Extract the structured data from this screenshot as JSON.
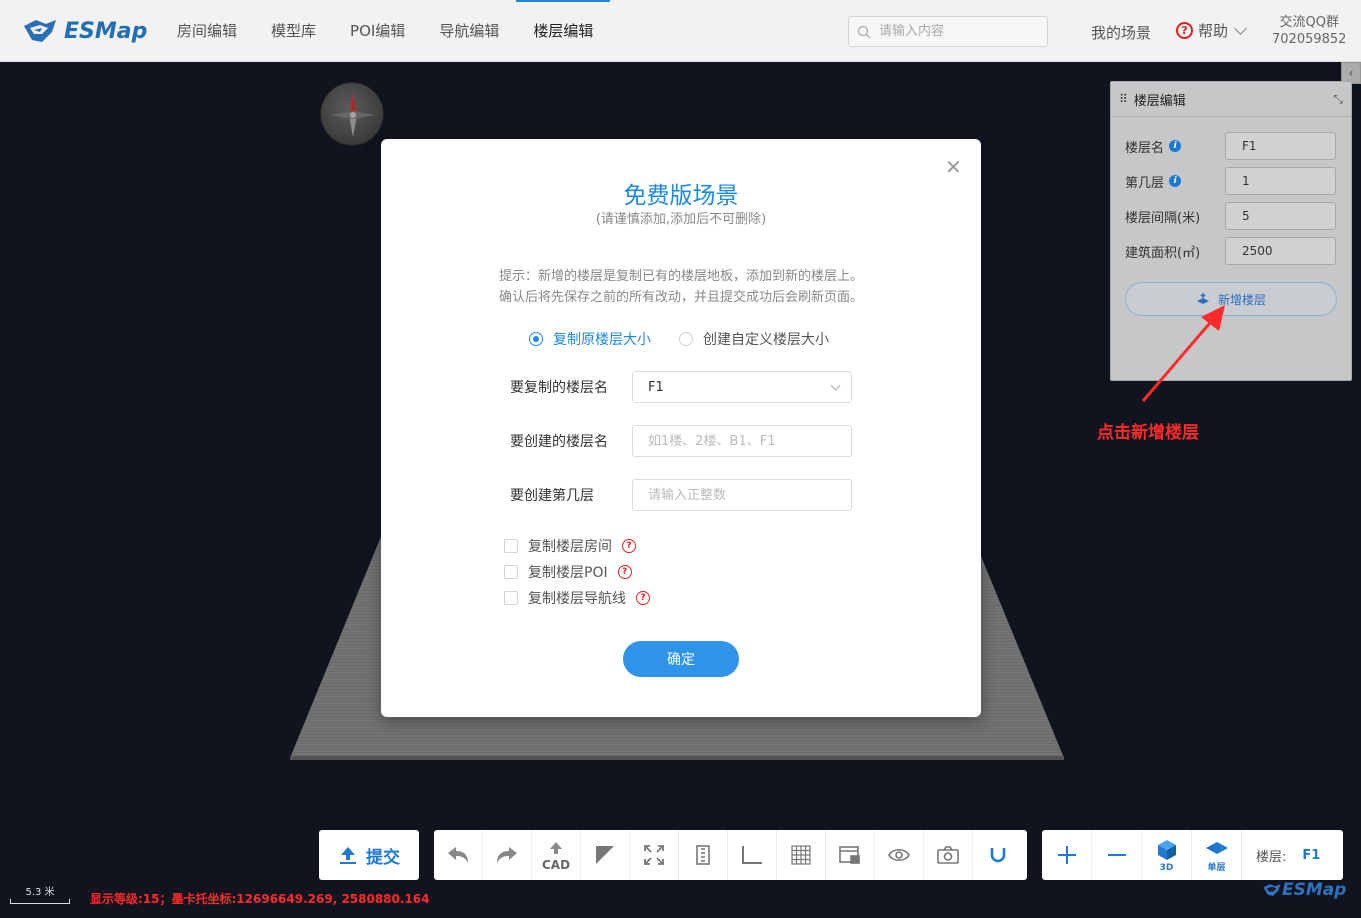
{
  "header": {
    "logo_text": "ESMap",
    "nav": [
      {
        "label": "房间编辑"
      },
      {
        "label": "模型库"
      },
      {
        "label": "POI编辑"
      },
      {
        "label": "导航编辑"
      },
      {
        "label": "楼层编辑",
        "active": true
      }
    ],
    "search_placeholder": "请输入内容",
    "my_scene": "我的场景",
    "help": "帮助",
    "qq_label": "交流QQ群",
    "qq_number": "702059852"
  },
  "panel": {
    "title": "楼层编辑",
    "fields": [
      {
        "label": "楼层名",
        "value": "F1",
        "info": true
      },
      {
        "label": "第几层",
        "value": "1",
        "info": true
      },
      {
        "label": "楼层间隔(米)",
        "value": "5",
        "info": false
      },
      {
        "label": "建筑面积(㎡)",
        "value": "2500",
        "info": false
      }
    ],
    "add_button": "新增楼层"
  },
  "annotation": "点击新增楼层",
  "modal": {
    "title": "免费版场景",
    "subtitle": "(请谨慎添加,添加后不可删除)",
    "tip_line1": "提示：新增的楼层是复制已有的楼层地板，添加到新的楼层上。",
    "tip_line2": "确认后将先保存之前的所有改动，并且提交成功后会刷新页面。",
    "radio_copy": "复制原楼层大小",
    "radio_custom": "创建自定义楼层大小",
    "selected_radio": "复制原楼层大小",
    "copy_floor_label": "要复制的楼层名",
    "copy_floor_value": "F1",
    "new_floor_label": "要创建的楼层名",
    "new_floor_placeholder": "如1楼、2楼、B1、F1",
    "floor_num_label": "要创建第几层",
    "floor_num_placeholder": "请输入正整数",
    "checkboxes": [
      "复制楼层房间",
      "复制楼层POI",
      "复制楼层导航线"
    ],
    "confirm": "确定"
  },
  "toolbar": {
    "submit": "提交",
    "cad": "CAD",
    "tool_icons": [
      "undo-icon",
      "redo-icon",
      "cad-upload-icon",
      "triangle-icon",
      "fullscreen-icon",
      "ruler-icon",
      "angle-icon",
      "grid-icon",
      "screen-icon",
      "eye-icon",
      "camera-icon",
      "magnet-icon"
    ],
    "zoom_in": "+",
    "zoom_out": "−",
    "view_3d": "3D",
    "single_floor": "单层",
    "floor_label": "楼层:",
    "floor_value": "F1"
  },
  "status": {
    "scale": "5.3 米",
    "text": "显示等级:15；墨卡托坐标:12696649.269, 2580880.164"
  },
  "watermark": "ESMap",
  "colors": {
    "accent": "#1e88e5",
    "annotation": "#ff2a2a",
    "scene_bg": "#141b2a"
  }
}
